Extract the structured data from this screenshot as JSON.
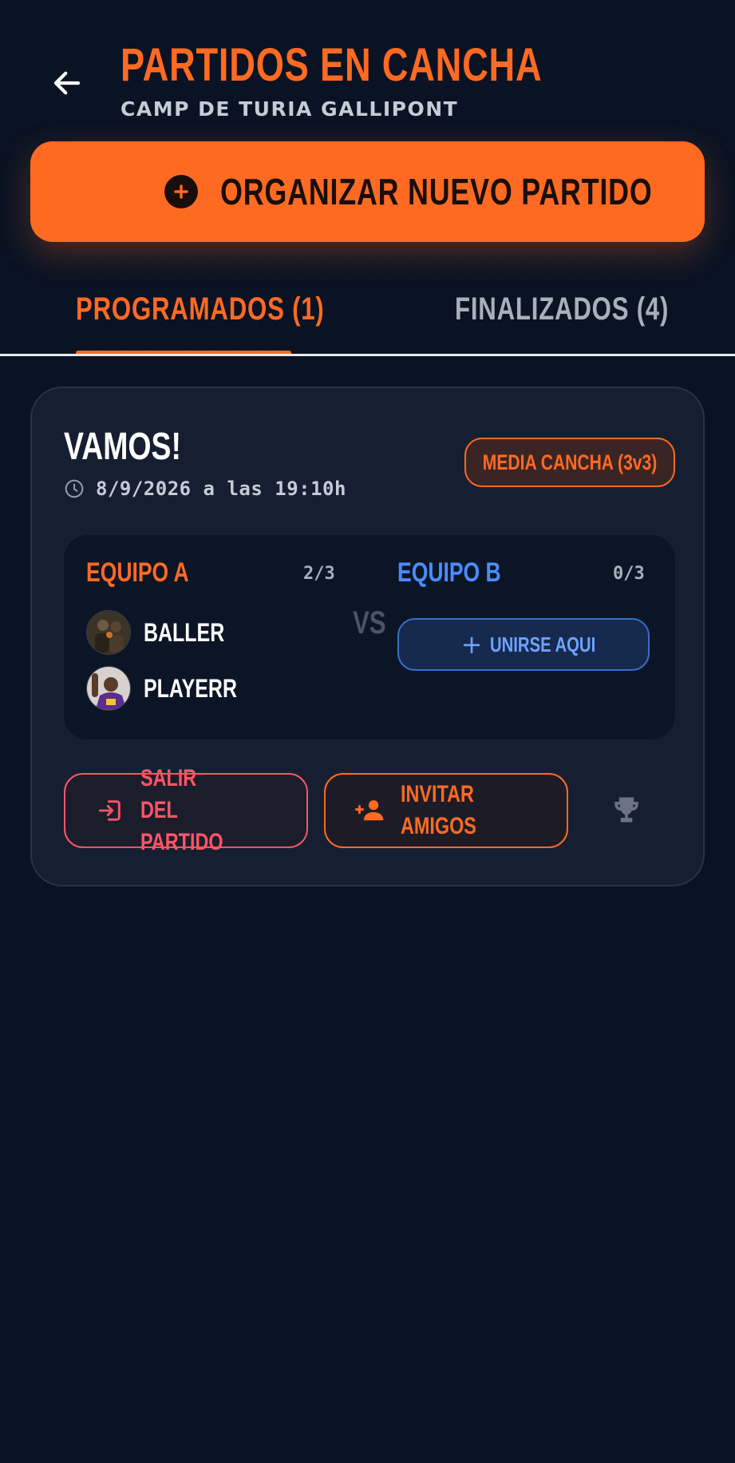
{
  "header": {
    "back_icon": "arrow-left-icon",
    "title": "PARTIDOS EN CANCHA",
    "subtitle": "CAMP DE TURIA GALLIPONT"
  },
  "primary_action": {
    "icon": "plus-circle-icon",
    "label": "ORGANIZAR NUEVO PARTIDO"
  },
  "tabs": [
    {
      "label": "PROGRAMADOS (1)",
      "active": true
    },
    {
      "label": "FINALIZADOS (4)",
      "active": false
    }
  ],
  "match": {
    "name": "VAMOS!",
    "datetime": "8/9/2026 a las 19:10h",
    "court_type": "MEDIA CANCHA (3v3)",
    "vs": "VS",
    "team_a": {
      "title": "EQUIPO A",
      "count": "2/3",
      "players": [
        {
          "name": "BALLER",
          "avatar": "avatar-icon"
        },
        {
          "name": "PLAYERR",
          "avatar": "avatar-icon"
        }
      ]
    },
    "team_b": {
      "title": "EQUIPO B",
      "count": "0/3",
      "join_label": "UNIRSE AQUI"
    },
    "actions": {
      "leave_line1": "SALIR DEL",
      "leave_line2": "PARTIDO",
      "invite_line1": "INVITAR",
      "invite_line2": "AMIGOS",
      "trophy_icon": "trophy-icon"
    }
  },
  "colors": {
    "background": "#0a1323",
    "accent": "#ff6a23",
    "team_b": "#4a8cff",
    "danger": "#ff5468",
    "card": "#161f31"
  }
}
